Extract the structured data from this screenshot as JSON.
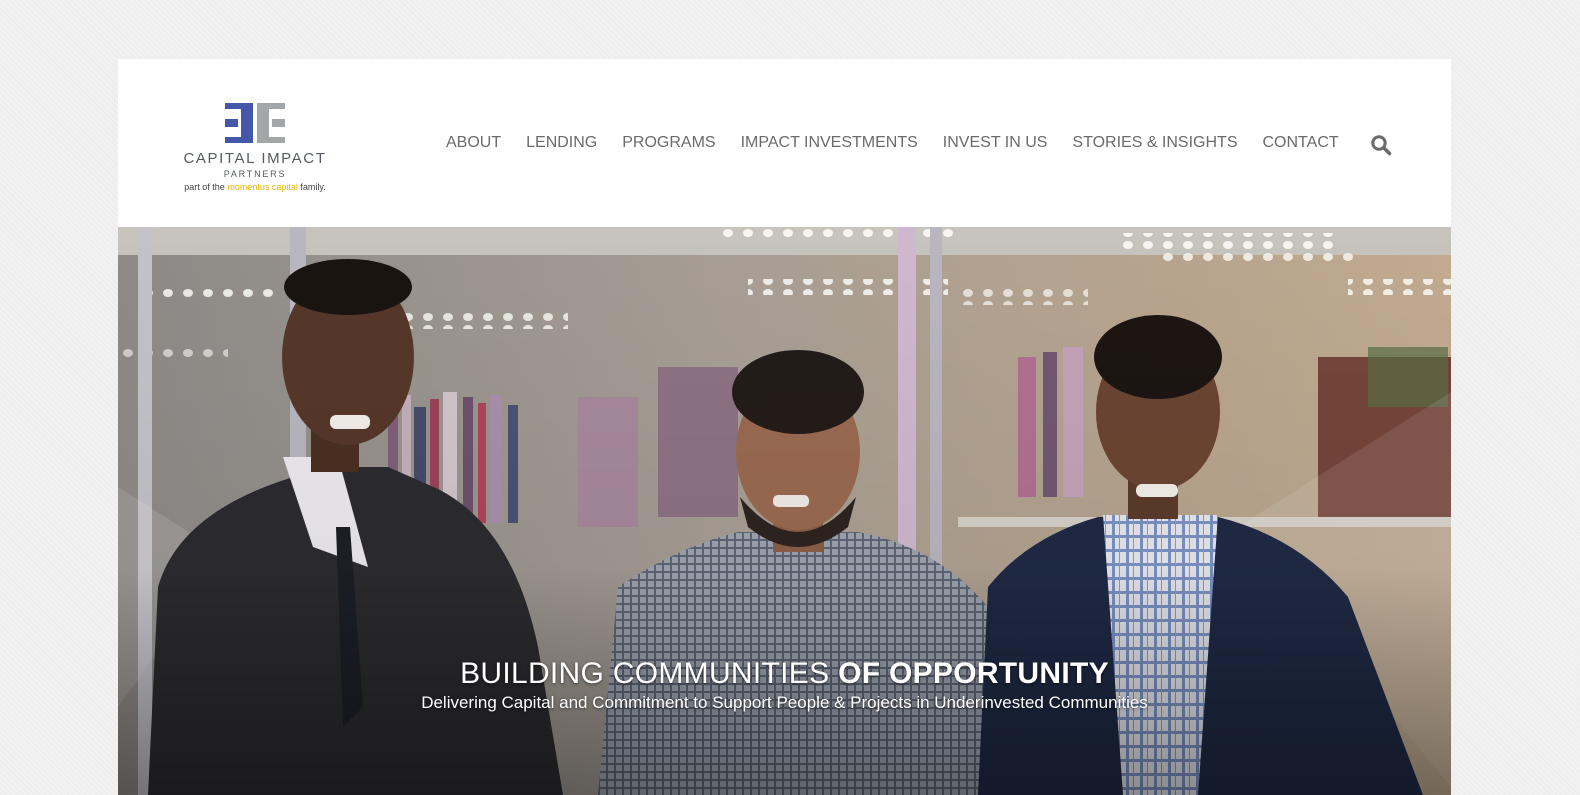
{
  "brand": {
    "name": "CAPITAL IMPACT",
    "subtitle": "PARTNERS",
    "tag_prefix": "part of the",
    "tag_highlight": "momentus capital",
    "tag_suffix": "family.",
    "colors": {
      "blue": "#4557a8",
      "gray": "#a4a7aa",
      "gold": "#e8b400"
    }
  },
  "nav": {
    "items": [
      {
        "label": "ABOUT"
      },
      {
        "label": "LENDING"
      },
      {
        "label": "PROGRAMS"
      },
      {
        "label": "IMPACT INVESTMENTS"
      },
      {
        "label": "INVEST IN US"
      },
      {
        "label": "STORIES & INSIGHTS"
      },
      {
        "label": "CONTACT"
      }
    ],
    "search_icon": "search-icon"
  },
  "hero": {
    "title_light": "BUILDING COMMUNITIES",
    "title_bold": "OF OPPORTUNITY",
    "subtitle": "Delivering Capital and Commitment to Support People & Projects in Underinvested Communities"
  }
}
